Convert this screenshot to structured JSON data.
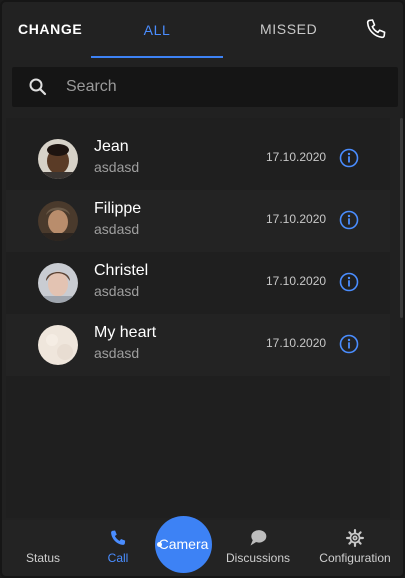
{
  "tabs": {
    "change": "CHANGE",
    "all": "ALL",
    "missed": "MISSED",
    "active": "all"
  },
  "header_icons": [
    "phone-icon"
  ],
  "search": {
    "placeholder": "Search",
    "value": ""
  },
  "calls": [
    {
      "name": "Jean",
      "subtitle": "asdasd",
      "date": "17.10.2020",
      "avatar": "avatar-jean"
    },
    {
      "name": "Filippe",
      "subtitle": "asdasd",
      "date": "17.10.2020",
      "avatar": "avatar-filippe"
    },
    {
      "name": "Christel",
      "subtitle": "asdasd",
      "date": "17.10.2020",
      "avatar": "avatar-christel"
    },
    {
      "name": "My heart",
      "subtitle": "asdasd",
      "date": "17.10.2020",
      "avatar": "avatar-my-heart"
    }
  ],
  "bottom_nav": {
    "status": "Status",
    "call": "Call",
    "camera": "Camera",
    "discussions": "Discussions",
    "configuration": "Configuration",
    "active": "call"
  },
  "colors": {
    "accent": "#3d82f5",
    "background": "#212121",
    "text_secondary": "#9e9e9e"
  }
}
